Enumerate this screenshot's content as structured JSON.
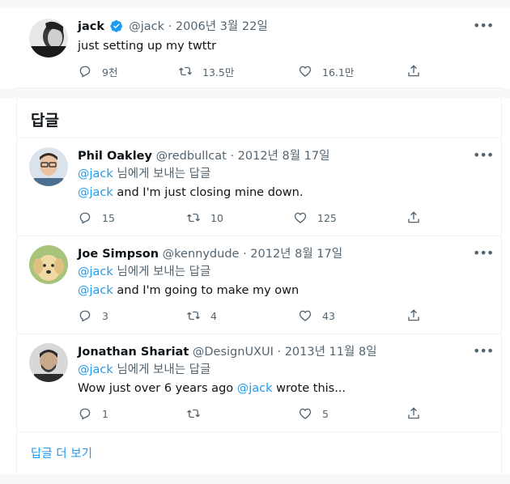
{
  "original": {
    "name": "jack",
    "handle": "@jack",
    "date": "· 2006년 3월 22일",
    "text": "just setting up my twttr",
    "replies": "9천",
    "retweets": "13.5만",
    "likes": "16.1만"
  },
  "replies_section": {
    "title": "답글",
    "show_more": "답글 더 보기"
  },
  "replies": [
    {
      "name": "Phil Oakley",
      "handle": "@redbullcat",
      "date": "· 2012년 8월 17일",
      "replying_to": "@jack",
      "replying_suffix": " 님에게 보내는 답글",
      "text_prefix": "",
      "mention": "@jack",
      "text_suffix": " and I'm just closing mine down.",
      "replies": "15",
      "retweets": "10",
      "likes": "125"
    },
    {
      "name": "Joe Simpson",
      "handle": "@kennydude",
      "date": "· 2012년 8월 17일",
      "replying_to": "@jack",
      "replying_suffix": " 님에게 보내는 답글",
      "text_prefix": "",
      "mention": "@jack",
      "text_suffix": " and I'm going to make my own",
      "replies": "3",
      "retweets": "4",
      "likes": "43"
    },
    {
      "name": "Jonathan Shariat",
      "handle": "@DesignUXUI",
      "date": "· 2013년 11월 8일",
      "replying_to": "@jack",
      "replying_suffix": " 님에게 보내는 답글",
      "text_prefix": "Wow just over 6 years ago ",
      "mention": "@jack",
      "text_suffix": " wrote this...",
      "replies": "1",
      "retweets": "",
      "likes": "5"
    }
  ],
  "colors": {
    "accent": "#1d9bf0",
    "muted": "#536471",
    "verified": "#1d9bf0"
  }
}
